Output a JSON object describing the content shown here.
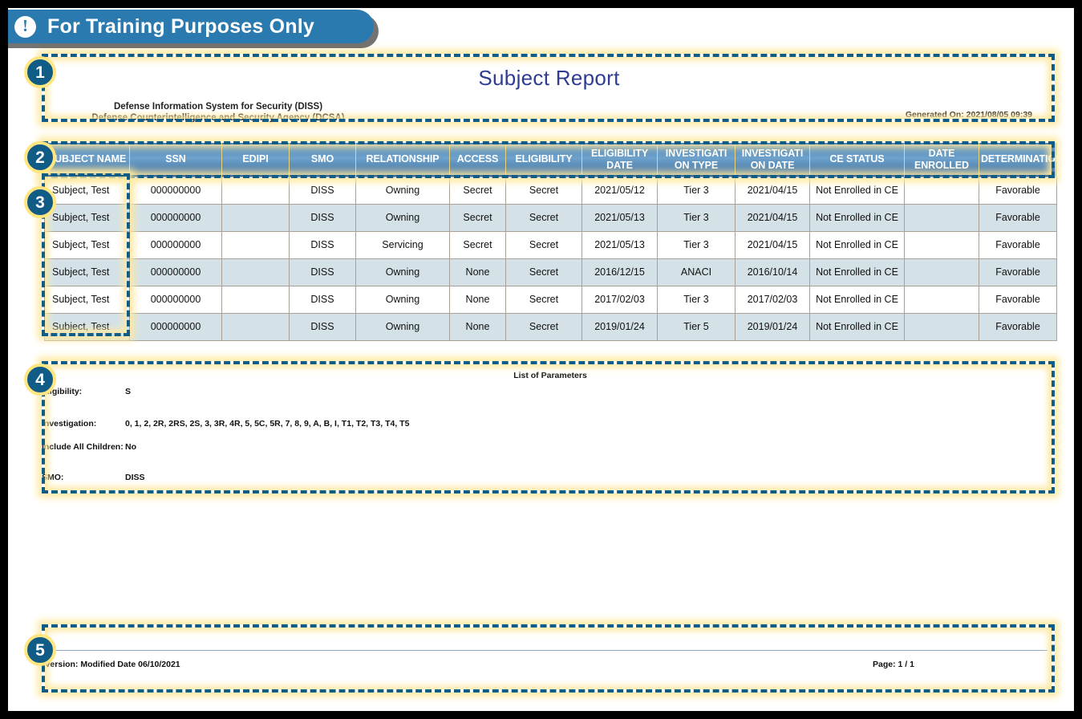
{
  "banner": {
    "icon": "exclamation-icon",
    "text": "For Training Purposes Only"
  },
  "callouts": {
    "n1": "1",
    "n2": "2",
    "n3": "3",
    "n4": "4",
    "n5": "5"
  },
  "header": {
    "title": "Subject Report",
    "agency_line1": "Defense Information System for Security (DISS)",
    "agency_line2": "Defense Counterintelligence and Security Agency (DCSA)",
    "generated_on": "Generated On:  2021/08/05 09:39"
  },
  "table": {
    "columns": [
      "SUBJECT NAME",
      "SSN",
      "EDIPI",
      "SMO",
      "RELATIONSHIP",
      "ACCESS",
      "ELIGIBILITY",
      "ELIGIBILITY DATE",
      "INVESTIGATI ON TYPE",
      "INVESTIGATI ON DATE",
      "CE STATUS",
      "DATE ENROLLED",
      "DETERMINATION"
    ],
    "rows": [
      [
        "Subject, Test",
        "000000000",
        "",
        "DISS",
        "Owning",
        "Secret",
        "Secret",
        "2021/05/12",
        "Tier 3",
        "2021/04/15",
        "Not Enrolled in CE",
        "",
        "Favorable"
      ],
      [
        "Subject, Test",
        "000000000",
        "",
        "DISS",
        "Owning",
        "Secret",
        "Secret",
        "2021/05/13",
        "Tier 3",
        "2021/04/15",
        "Not Enrolled in CE",
        "",
        "Favorable"
      ],
      [
        "Subject, Test",
        "000000000",
        "",
        "DISS",
        "Servicing",
        "Secret",
        "Secret",
        "2021/05/13",
        "Tier 3",
        "2021/04/15",
        "Not Enrolled in CE",
        "",
        "Favorable"
      ],
      [
        "Subject, Test",
        "000000000",
        "",
        "DISS",
        "Owning",
        "None",
        "Secret",
        "2016/12/15",
        "ANACI",
        "2016/10/14",
        "Not Enrolled in CE",
        "",
        "Favorable"
      ],
      [
        "Subject, Test",
        "000000000",
        "",
        "DISS",
        "Owning",
        "None",
        "Secret",
        "2017/02/03",
        "Tier 3",
        "2017/02/03",
        "Not Enrolled in CE",
        "",
        "Favorable"
      ],
      [
        "Subject, Test",
        "000000000",
        "",
        "DISS",
        "Owning",
        "None",
        "Secret",
        "2019/01/24",
        "Tier 5",
        "2019/01/24",
        "Not Enrolled in CE",
        "",
        "Favorable"
      ]
    ]
  },
  "parameters": {
    "title": "List of Parameters",
    "items": [
      {
        "label": "Eligibility:",
        "value": "S"
      },
      {
        "label": "Investigation:",
        "value": "0, 1, 2, 2R, 2RS, 2S, 3, 3R, 4R, 5, 5C, 5R, 7, 8, 9, A, B, I, T1, T2, T3, T4, T5"
      },
      {
        "label": "Include All Children:",
        "value": "No"
      },
      {
        "label": "SMO:",
        "value": "DISS"
      }
    ]
  },
  "footer": {
    "version": "Version: Modified Date 06/10/2021",
    "page": "Page: 1 / 1"
  },
  "colors": {
    "banner_blue": "#2a7ab0",
    "callout_blue": "#115c86",
    "callout_glow": "#ffe9a0",
    "title_blue": "#2e3d91",
    "header_blue": "#5b93c2",
    "row_alt": "#d4e2e7"
  }
}
